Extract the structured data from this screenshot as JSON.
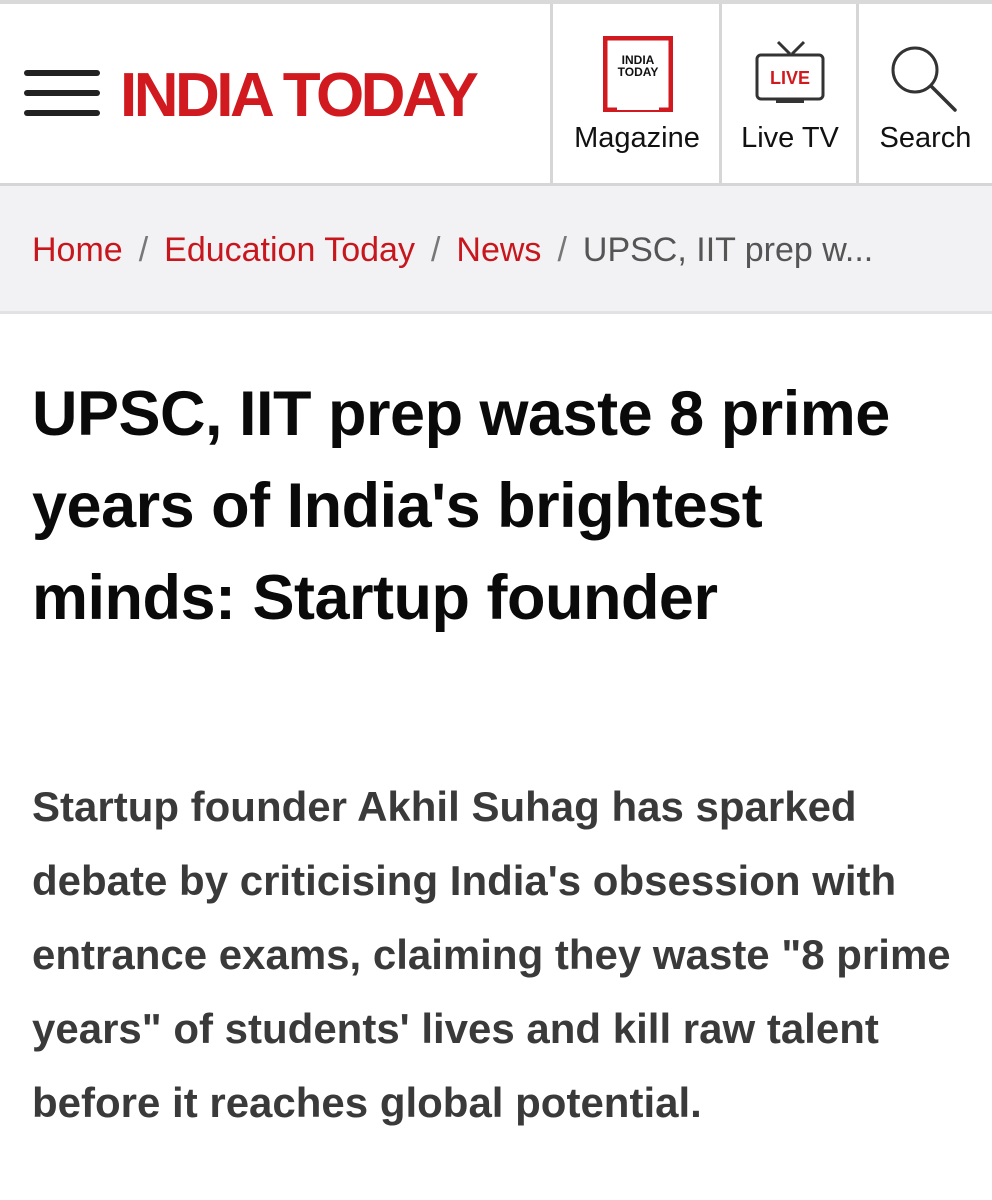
{
  "header": {
    "logo_text": "INDIA TODAY",
    "brand_color": "#d11a1f",
    "menu_icon": "hamburger-menu-icon",
    "nav": [
      {
        "label": "Magazine",
        "icon": "magazine-icon",
        "icon_text": [
          "INDIA",
          "TODAY"
        ]
      },
      {
        "label": "Live TV",
        "icon": "live-tv-icon",
        "icon_text": "LIVE"
      },
      {
        "label": "Search",
        "icon": "search-icon"
      }
    ]
  },
  "breadcrumb": {
    "items": [
      "Home",
      "Education Today",
      "News"
    ],
    "separator": "/",
    "current": "UPSC, IIT prep w..."
  },
  "article": {
    "headline": "UPSC, IIT prep waste 8 prime years of India's brightest minds: Startup founder",
    "summary": "Startup founder Akhil Suhag has sparked debate by criticising India's obsession with entrance exams, claiming they waste \"8 prime years\" of students' lives and kill raw talent before it reaches global potential."
  }
}
